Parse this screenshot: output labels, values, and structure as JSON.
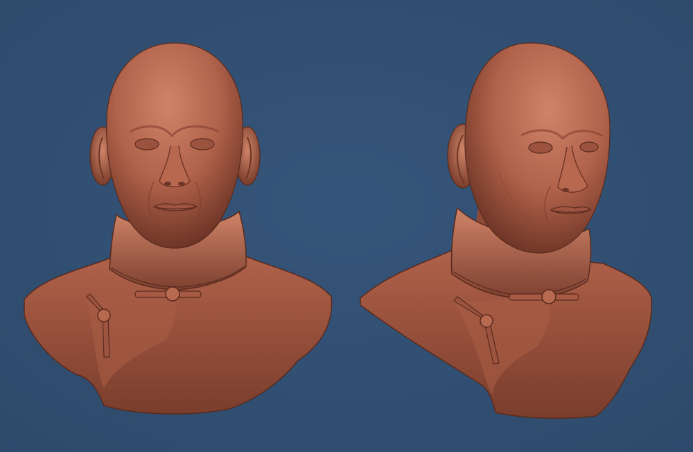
{
  "scene": {
    "colors": {
      "background": "#2e4a6b",
      "background_light": "#35557a",
      "clay": "#b0624a",
      "clay_highlight": "#cf8468",
      "clay_shadow": "#6e3526",
      "clay_outline": "#5a2a1d"
    },
    "busts": [
      {
        "view": "front"
      },
      {
        "view": "three-quarter"
      }
    ]
  }
}
